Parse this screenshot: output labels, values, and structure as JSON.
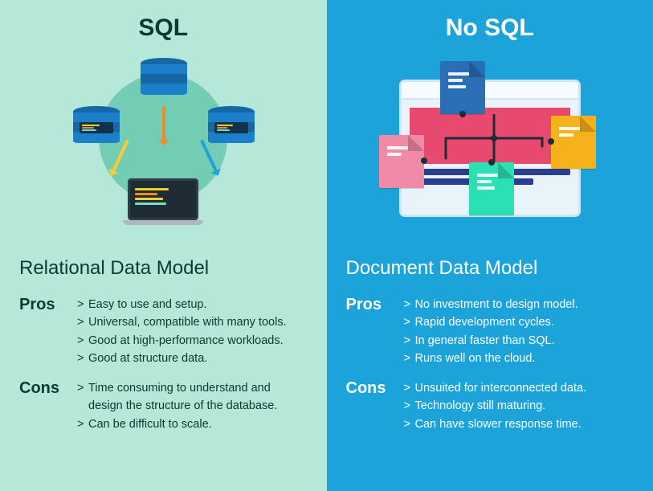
{
  "left": {
    "title": "SQL",
    "model": "Relational Data Model",
    "pros_label": "Pros",
    "cons_label": "Cons",
    "pros": [
      "Easy to use and setup.",
      "Universal, compatible with many tools.",
      "Good at high-performance workloads.",
      "Good at structure data."
    ],
    "cons": [
      "Time consuming to understand and design the structure of the database.",
      "Can be difficult to scale."
    ]
  },
  "right": {
    "title": "No SQL",
    "model": "Document Data Model",
    "pros_label": "Pros",
    "cons_label": "Cons",
    "pros": [
      "No investment to design model.",
      "Rapid development cycles.",
      "In general faster than SQL.",
      "Runs well on the cloud."
    ],
    "cons": [
      "Unsuited for interconnected data.",
      "Technology still maturing.",
      "Can have slower response time."
    ]
  }
}
